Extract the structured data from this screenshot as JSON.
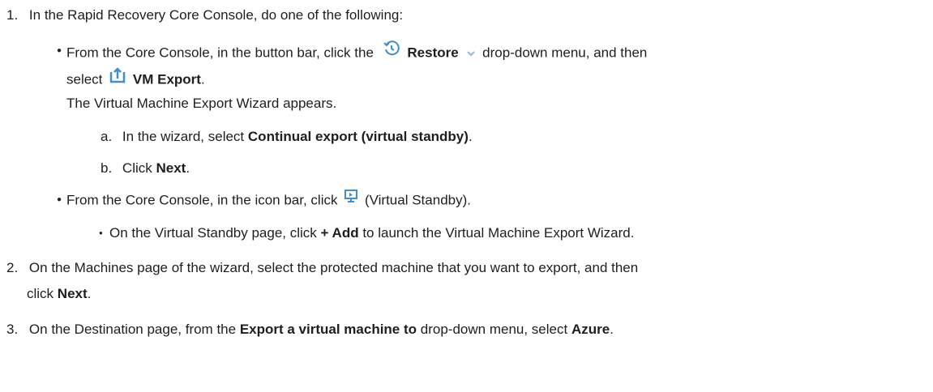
{
  "step1": {
    "num": "1.",
    "text": "In the Rapid Recovery Core Console, do one of the following:",
    "bullet1": {
      "pre": "From the Core Console, in the button bar, click the",
      "restore": "Restore",
      "post": "drop-down menu, and then",
      "select": "select",
      "vm_export": "VM Export",
      "period": ".",
      "note": "The Virtual Machine Export Wizard appears.",
      "sub_a": {
        "letter": "a.",
        "pre": "In the wizard, select",
        "bold": "Continual export (virtual standby)",
        "post": "."
      },
      "sub_b": {
        "letter": "b.",
        "pre": "Click",
        "bold": "Next",
        "post": "."
      }
    },
    "bullet2": {
      "pre": "From the Core Console, in the icon bar, click",
      "post": "(Virtual Standby).",
      "sub": {
        "pre": "On the Virtual Standby page, click",
        "bold": "+ Add",
        "post": "to launch the Virtual Machine Export Wizard."
      }
    }
  },
  "step2": {
    "num": "2.",
    "line1": "On the Machines page of the wizard, select the protected machine that you want to export, and then",
    "pre": "click",
    "bold": "Next",
    "post": "."
  },
  "step3": {
    "num": "3.",
    "pre": "On the Destination page, from the",
    "bold1": "Export a virtual machine to",
    "mid": "drop-down menu, select",
    "bold2": "Azure",
    "post": "."
  },
  "icons": {
    "restore": "restore-history-icon",
    "dropdown": "chevron-down-icon",
    "vm_export": "export-upload-icon",
    "virtual_standby": "virtual-standby-monitor-icon"
  },
  "colors": {
    "text": "#1e1e1e",
    "icon_blue": "#3d8fd1",
    "chevron": "#8fb8dd"
  }
}
